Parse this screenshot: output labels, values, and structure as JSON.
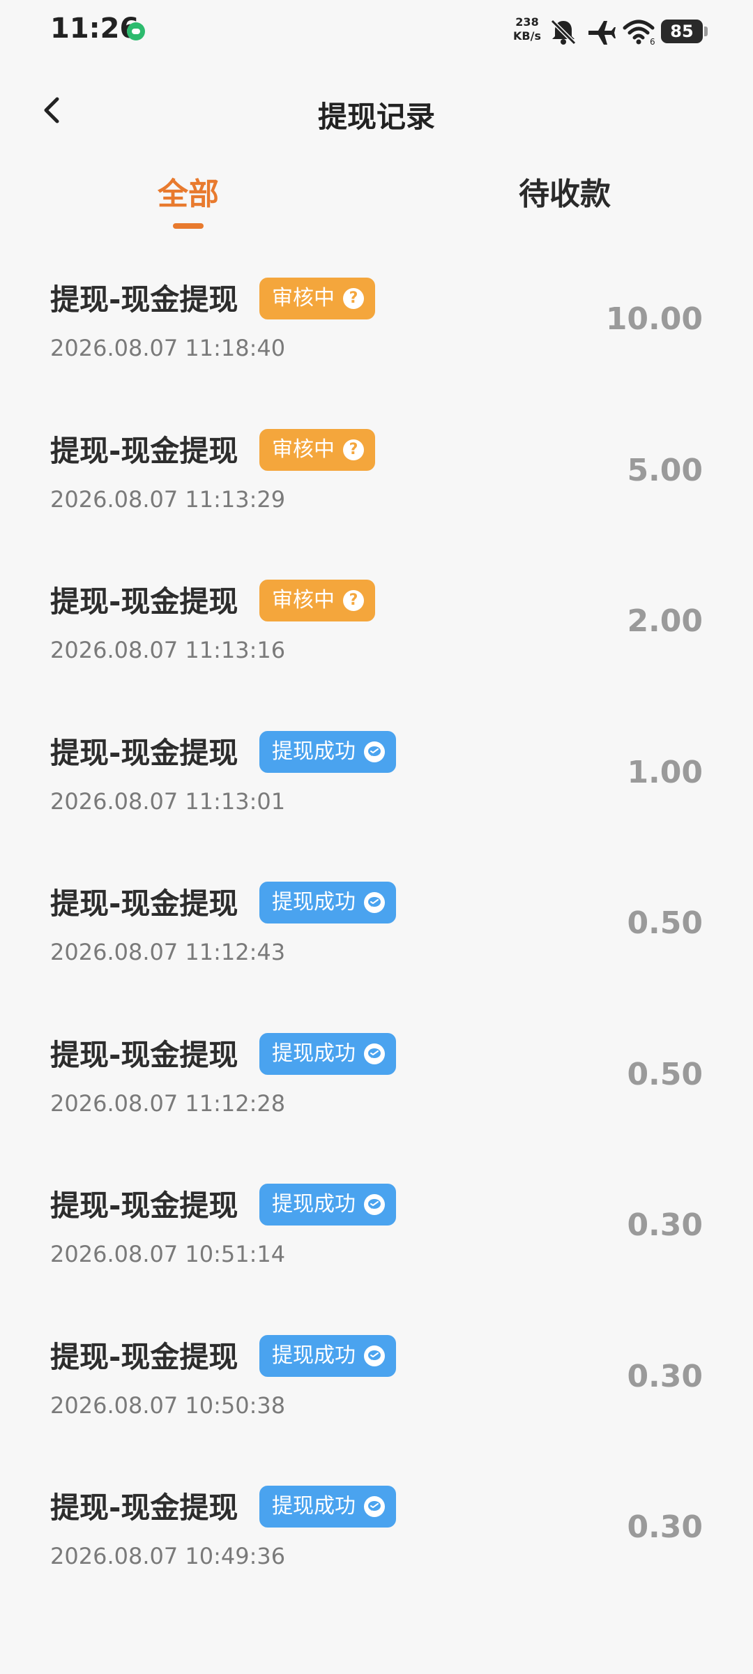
{
  "status_bar": {
    "time": "11:26",
    "net_speed_value": "238",
    "net_speed_unit": "KB/s",
    "battery": "85",
    "icons": [
      "app-notification-icon",
      "bell-off-icon",
      "airplane-icon",
      "wifi-icon",
      "battery-icon"
    ]
  },
  "header": {
    "title": "提现记录"
  },
  "tabs": [
    {
      "label": "全部",
      "active": true
    },
    {
      "label": "待收款",
      "active": false
    }
  ],
  "records": [
    {
      "title": "提现-现金提现",
      "status": "审核中",
      "status_type": "review",
      "time": "2026.08.07 11:18:40",
      "amount": "10.00"
    },
    {
      "title": "提现-现金提现",
      "status": "审核中",
      "status_type": "review",
      "time": "2026.08.07 11:13:29",
      "amount": "5.00"
    },
    {
      "title": "提现-现金提现",
      "status": "审核中",
      "status_type": "review",
      "time": "2026.08.07 11:13:16",
      "amount": "2.00"
    },
    {
      "title": "提现-现金提现",
      "status": "提现成功",
      "status_type": "success",
      "time": "2026.08.07 11:13:01",
      "amount": "1.00"
    },
    {
      "title": "提现-现金提现",
      "status": "提现成功",
      "status_type": "success",
      "time": "2026.08.07 11:12:43",
      "amount": "0.50"
    },
    {
      "title": "提现-现金提现",
      "status": "提现成功",
      "status_type": "success",
      "time": "2026.08.07 11:12:28",
      "amount": "0.50"
    },
    {
      "title": "提现-现金提现",
      "status": "提现成功",
      "status_type": "success",
      "time": "2026.08.07 10:51:14",
      "amount": "0.30"
    },
    {
      "title": "提现-现金提现",
      "status": "提现成功",
      "status_type": "success",
      "time": "2026.08.07 10:50:38",
      "amount": "0.30"
    },
    {
      "title": "提现-现金提现",
      "status": "提现成功",
      "status_type": "success",
      "time": "2026.08.07 10:49:36",
      "amount": "0.30"
    }
  ],
  "colors": {
    "accent": "#e87a2e",
    "review_badge": "#f4a63c",
    "success_badge": "#4aa3ef",
    "amount": "#9a9a9a"
  }
}
